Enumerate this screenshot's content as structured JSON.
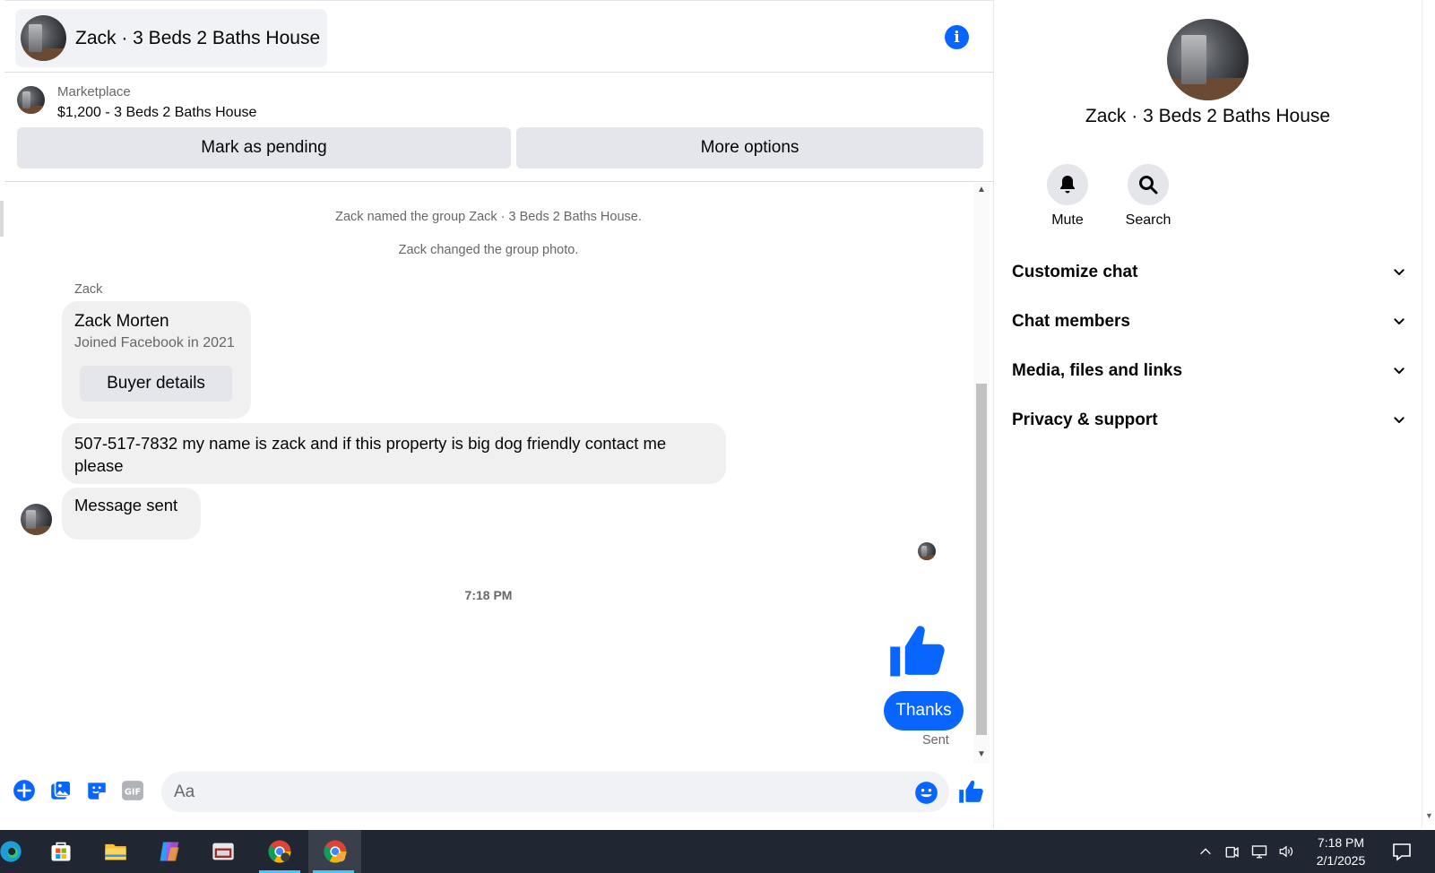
{
  "chat": {
    "title": "Zack · 3 Beds 2 Baths House",
    "listing": {
      "source": "Marketplace",
      "title": "$1,200 - 3 Beds 2 Baths House",
      "mark_pending_label": "Mark as pending",
      "more_options_label": "More options"
    },
    "messages": {
      "system_1": "Zack named the group Zack · 3 Beds 2 Baths House.",
      "system_2": "Zack changed the group photo.",
      "sender_name": "Zack",
      "profile_card": {
        "name": "Zack Morten",
        "joined": "Joined Facebook in 2021",
        "button_label": "Buyer details"
      },
      "msg_1": "507-517-7832 my name is zack and if this property is big dog friendly contact me please",
      "msg_2": "Message sent",
      "timestamp": "7:18 PM",
      "outgoing_text": "Thanks",
      "outgoing_status": "Sent"
    },
    "composer": {
      "placeholder": "Aa"
    }
  },
  "details": {
    "title": "Zack · 3 Beds 2 Baths House",
    "actions": {
      "mute": "Mute",
      "search": "Search"
    },
    "sections": {
      "customize": "Customize chat",
      "members": "Chat members",
      "media": "Media, files and links",
      "privacy": "Privacy & support"
    }
  },
  "taskbar": {
    "time": "7:18 PM",
    "date": "2/1/2025"
  },
  "colors": {
    "accent": "#0866ff",
    "bubble_gray": "#f0f0f0",
    "taskbar": "#202733"
  }
}
